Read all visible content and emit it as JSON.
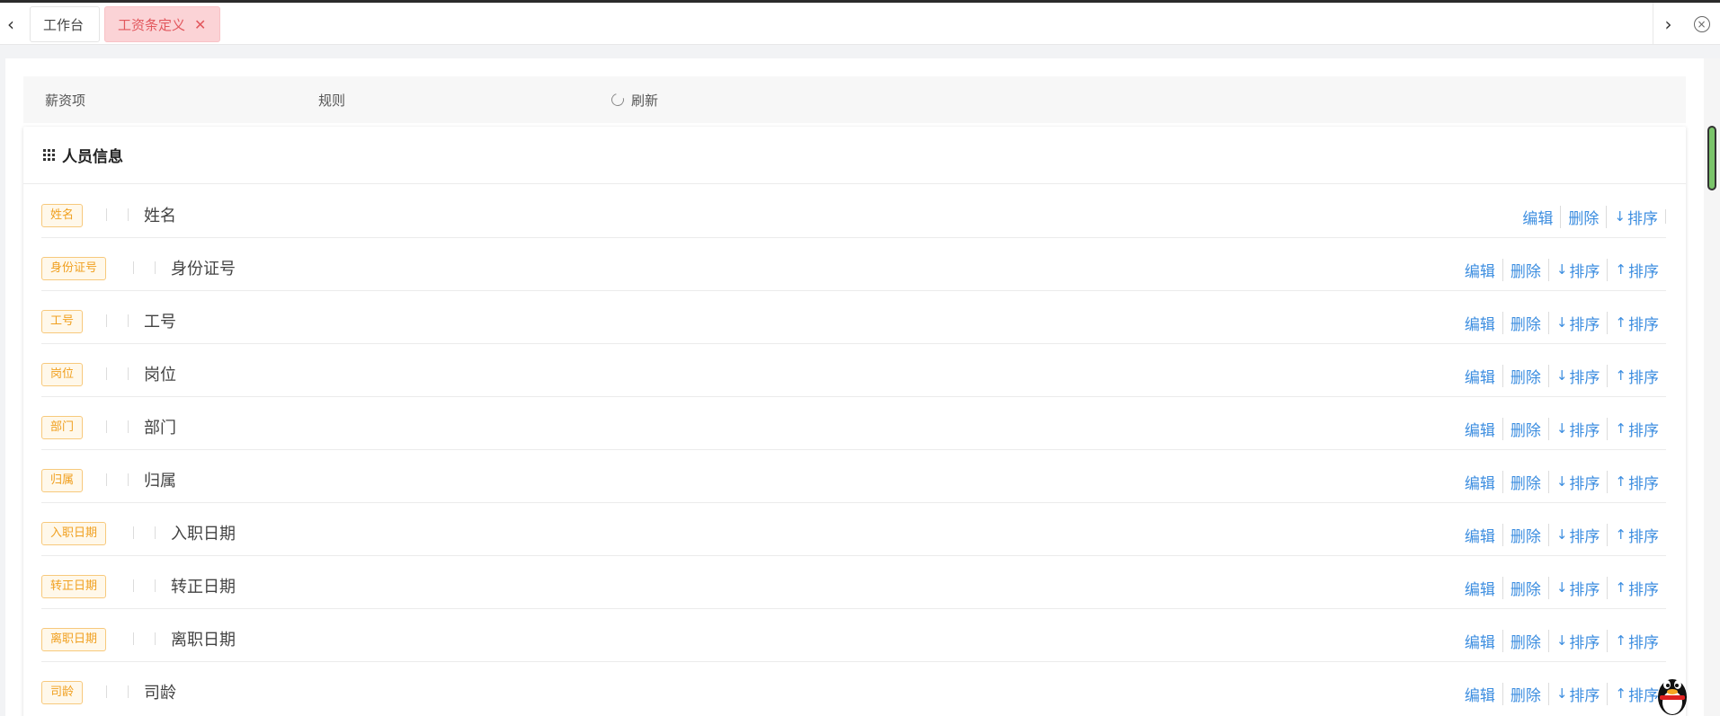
{
  "tabs": {
    "items": [
      {
        "label": "工作台"
      },
      {
        "label": "工资条定义"
      }
    ],
    "close_symbol": "✕"
  },
  "filter": {
    "salary_item_label": "薪资项",
    "rule_label": "规则",
    "refresh_label": "刷新"
  },
  "section": {
    "title": "人员信息"
  },
  "actions": {
    "edit": "编辑",
    "delete": "删除",
    "sort_down": "排序",
    "sort_up": "排序"
  },
  "rows": [
    {
      "tag": "姓名",
      "label": "姓名"
    },
    {
      "tag": "身份证号",
      "label": "身份证号"
    },
    {
      "tag": "工号",
      "label": "工号"
    },
    {
      "tag": "岗位",
      "label": "岗位"
    },
    {
      "tag": "部门",
      "label": "部门"
    },
    {
      "tag": "归属",
      "label": "归属"
    },
    {
      "tag": "入职日期",
      "label": "入职日期"
    },
    {
      "tag": "转正日期",
      "label": "转正日期"
    },
    {
      "tag": "离职日期",
      "label": "离职日期"
    },
    {
      "tag": "司龄",
      "label": "司龄"
    }
  ],
  "colors": {
    "active_tab_bg": "#fbd3d6",
    "active_tab_text": "#e2575d",
    "tag_border": "#f7c97c",
    "tag_text": "#f0a020",
    "action_link": "#3d8ee0"
  }
}
